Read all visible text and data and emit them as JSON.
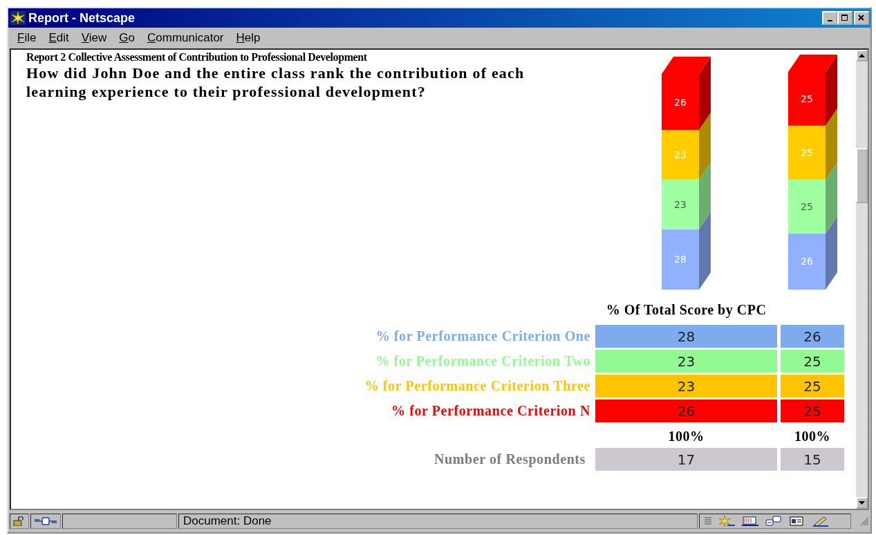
{
  "window": {
    "title": "Report - Netscape"
  },
  "menu": [
    "File",
    "Edit",
    "View",
    "Go",
    "Communicator",
    "Help"
  ],
  "report": {
    "subtitle": "Report 2 Collective Assessment of Contribution to Professional Development",
    "question": "How did John Doe and the entire class rank the contribution of each learning experience to their professional development?",
    "chart_data": {
      "type": "bar",
      "stacked": true,
      "data_labels": true,
      "value_labels": [
        [
          "28",
          "26"
        ],
        [
          "23",
          "25"
        ],
        [
          "23",
          "25"
        ],
        [
          "26",
          "25"
        ]
      ],
      "series": [
        {
          "color": "#91b1ff",
          "values": [
            28,
            26
          ]
        },
        {
          "color": "#a0ffa0",
          "values": [
            23,
            25
          ]
        },
        {
          "color": "#ffcc00",
          "values": [
            23,
            25
          ]
        },
        {
          "color": "#ff0000",
          "values": [
            26,
            25
          ]
        }
      ]
    },
    "table": {
      "header": "% Of Total Score by CPC",
      "rows": [
        {
          "label": "% for Performance Criterion One",
          "color": "#7eabed",
          "values": [
            "28",
            "26"
          ]
        },
        {
          "label": "% for Performance Criterion Two",
          "color": "#93f993",
          "values": [
            "23",
            "25"
          ]
        },
        {
          "label": "% for Performance Criterion Three",
          "color": "#ffc400",
          "values": [
            "23",
            "25"
          ]
        },
        {
          "label": "% for Performance Criterion N",
          "color": "#ff0000",
          "values": [
            "26",
            "25"
          ]
        }
      ],
      "totals": [
        "100%",
        "100%"
      ],
      "respondents": {
        "label": "Number of Respondents",
        "values": [
          "17",
          "15"
        ]
      }
    }
  },
  "status_bar": {
    "text": "Document: Done"
  }
}
